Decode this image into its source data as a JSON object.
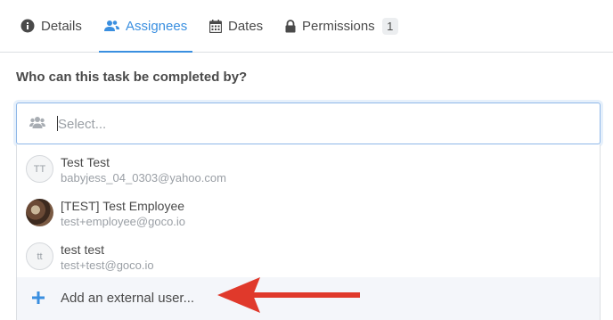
{
  "tabs": [
    {
      "label": "Details",
      "icon": "info-circle-icon"
    },
    {
      "label": "Assignees",
      "icon": "users-icon",
      "active": true
    },
    {
      "label": "Dates",
      "icon": "calendar-icon"
    },
    {
      "label": "Permissions",
      "icon": "lock-icon",
      "badge": "1"
    }
  ],
  "question": "Who can this task be completed by?",
  "select": {
    "placeholder": "Select...",
    "icon": "group-icon"
  },
  "options": [
    {
      "initials": "TT",
      "name": "Test Test",
      "email": "babyjess_04_0303@yahoo.com"
    },
    {
      "initials": "",
      "name": "[TEST] Test Employee",
      "email": "test+employee@goco.io"
    },
    {
      "initials": "tt",
      "name": "test test",
      "email": "test+test@goco.io"
    }
  ],
  "add_external": {
    "label": "Add an external user...",
    "icon": "plus-icon"
  },
  "colors": {
    "accent": "#3a8fe0",
    "arrow": "#e0392b",
    "text": "#4a4a4a",
    "muted": "#9a9fa5"
  }
}
